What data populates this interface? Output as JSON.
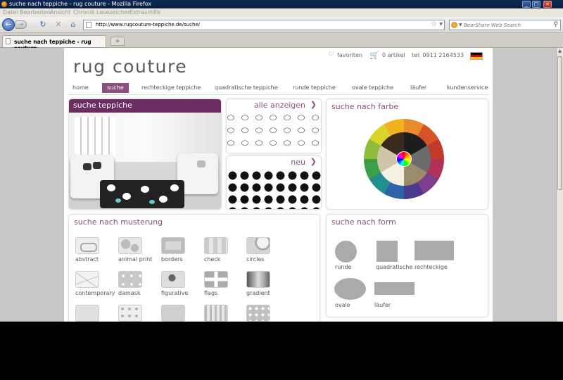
{
  "browser": {
    "window_title": "suche nach teppiche - rug couture - Mozilla Firefox",
    "window_controls": [
      "_",
      "□",
      "×"
    ],
    "menu": [
      "Datei",
      "Bearbeiten",
      "Ansicht",
      "Chronik",
      "Lesezeichen",
      "Extras",
      "Hilfe"
    ],
    "url": "http://www.rugcouture-teppiche.de/suche/",
    "search_placeholder": "BearShare Web Search",
    "tab_title": "suche nach teppiche - rug couture",
    "new_tab": "+"
  },
  "site": {
    "logo": "rug couture",
    "favorites": "favoriten",
    "cart": "0 artikel",
    "phone": "tel: 0911 2164533",
    "nav": [
      "home",
      "suche",
      "rechteckige teppiche",
      "quadratische teppiche",
      "runde teppiche",
      "ovale teppiche",
      "läufer",
      "kundenservice"
    ],
    "active_nav": "suche"
  },
  "cards": {
    "search_rugs": "suche teppiche",
    "show_all": "alle anzeigen",
    "new": "neu",
    "by_color": "suche nach farbe",
    "by_pattern": "suche nach musterung",
    "by_shape": "suche nach form"
  },
  "patterns": [
    "abstract",
    "animal print",
    "borders",
    "check",
    "circles",
    "contemporary",
    "damask",
    "figurative",
    "flags",
    "gradient"
  ],
  "shapes": [
    "runde",
    "quadratische",
    "rechteckige",
    "ovale",
    "läufer"
  ],
  "colors": {
    "brand_purple": "#8b4f7f",
    "dark_purple": "#6b2d5f"
  }
}
